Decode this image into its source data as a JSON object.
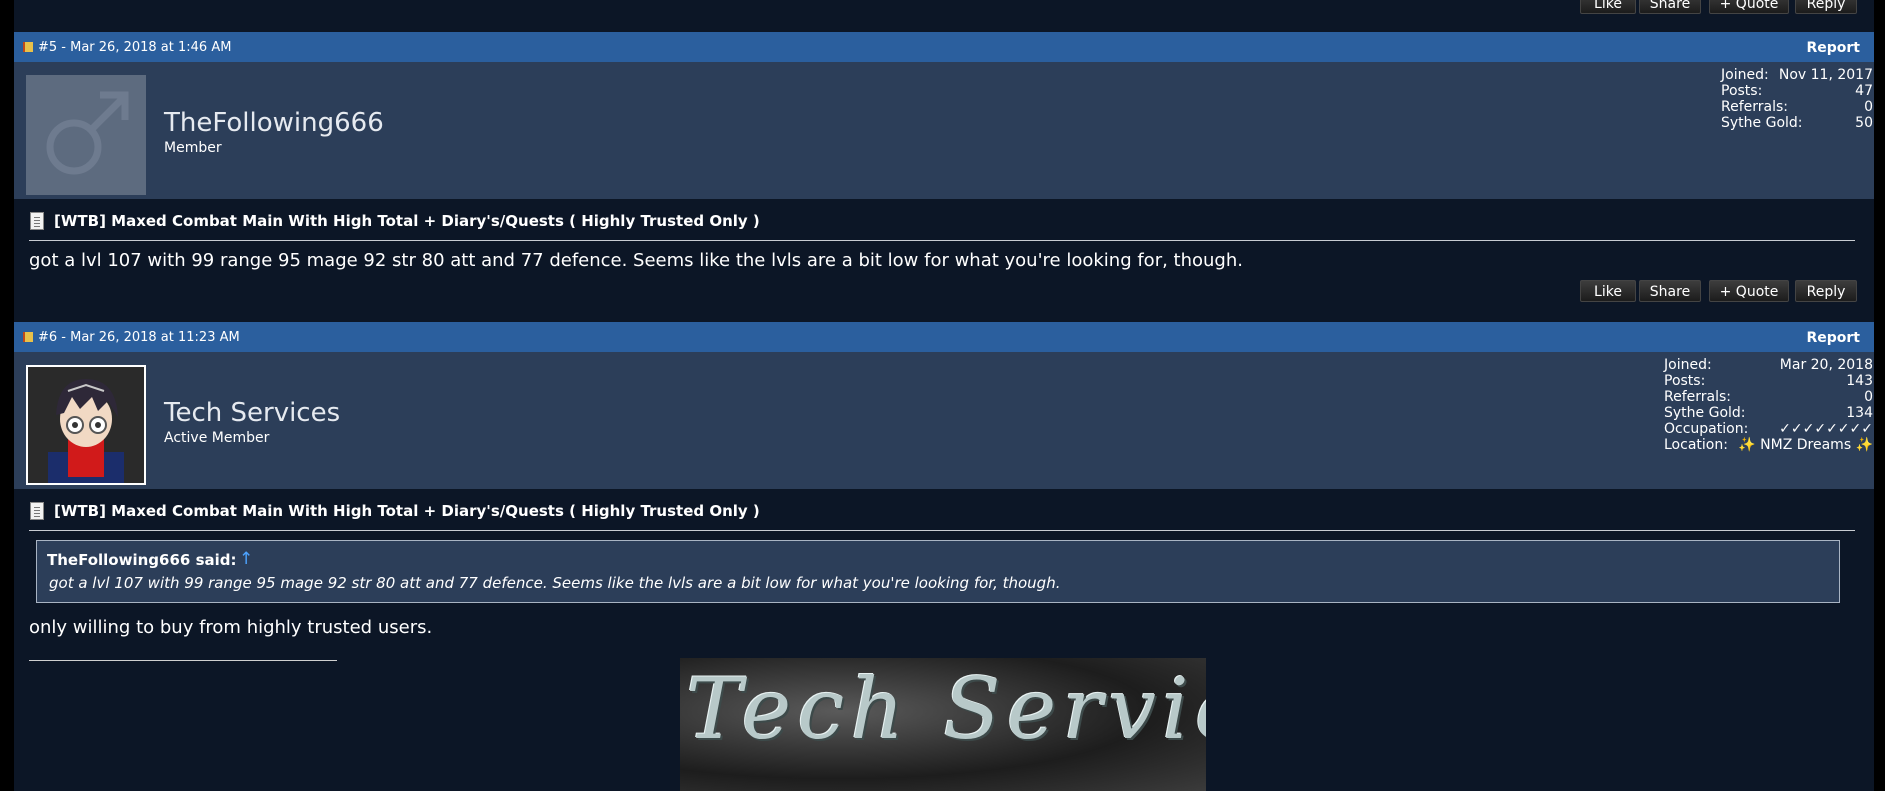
{
  "top_buttons": [
    "Like",
    "Share",
    "+ Quote",
    "Reply"
  ],
  "post5": {
    "number_date": "#5 - Mar 26, 2018 at 1:46 AM",
    "report": "Report",
    "username": "TheFollowing666",
    "rank": "Member",
    "stats": [
      {
        "label": "Joined:",
        "value": "Nov 11, 2017"
      },
      {
        "label": "Posts:",
        "value": "47"
      },
      {
        "label": "Referrals:",
        "value": "0"
      },
      {
        "label": "Sythe Gold:",
        "value": "50"
      }
    ],
    "thread_title": "[WTB] Maxed Combat Main With High Total + Diary's/Quests ( Highly Trusted Only )",
    "message": "got a lvl 107 with 99 range 95 mage 92 str 80 att and 77 defence. Seems like the lvls are a bit low for what you're looking for, though.",
    "buttons": [
      "Like",
      "Share",
      "+ Quote",
      "Reply"
    ]
  },
  "post6": {
    "number_date": "#6 - Mar 26, 2018 at 11:23 AM",
    "report": "Report",
    "username": "Tech Services",
    "rank": "Active Member",
    "stats": [
      {
        "label": "Joined:",
        "value": "Mar 20, 2018"
      },
      {
        "label": "Posts:",
        "value": "143"
      },
      {
        "label": "Referrals:",
        "value": "0"
      },
      {
        "label": "Sythe Gold:",
        "value": "134"
      },
      {
        "label": "Occupation:",
        "value": "✓✓✓✓✓✓✓✓"
      },
      {
        "label": "Location:",
        "value": "✨ NMZ Dreams ✨"
      }
    ],
    "thread_title": "[WTB] Maxed Combat Main With High Total + Diary's/Quests ( Highly Trusted Only )",
    "quote_author": "TheFollowing666 said:",
    "quote_arrow": "↑",
    "quote_text": "got a lvl 107 with 99 range 95 mage 92 str 80 att and 77 defence. Seems like the lvls are a bit low for what you're looking for, though.",
    "message": "only willing to buy from highly trusted users.",
    "signature_banner": "Tech Services"
  }
}
